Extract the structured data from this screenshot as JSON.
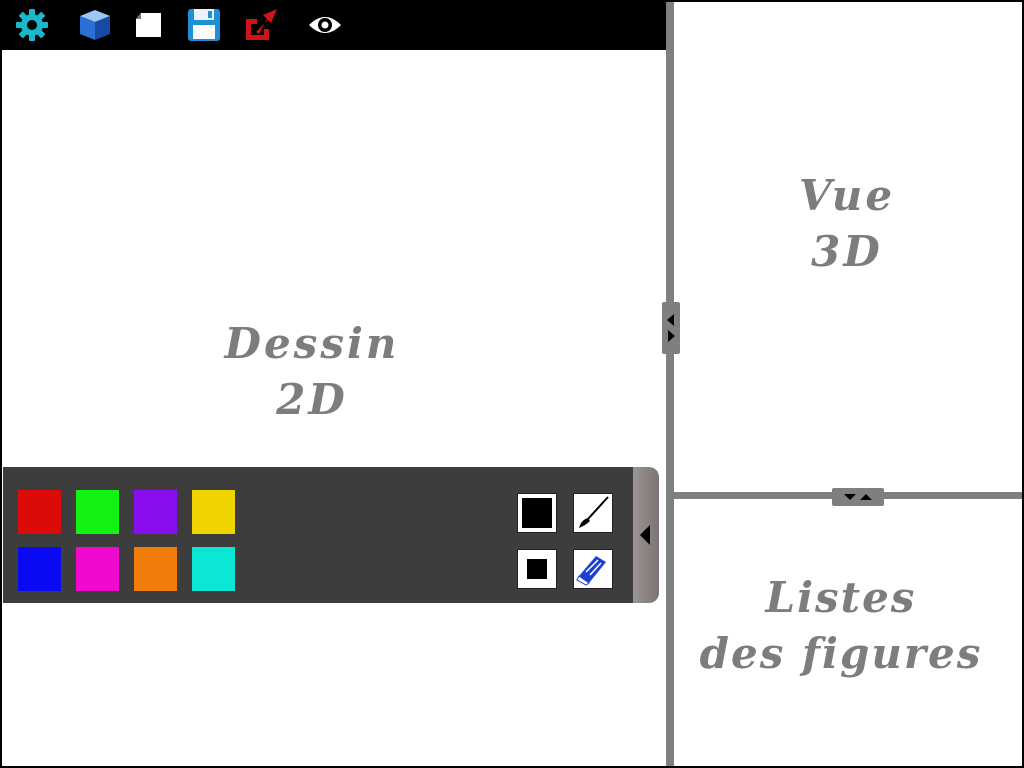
{
  "toolbar": {
    "buttons": [
      {
        "name": "settings",
        "icon": "gear-icon",
        "color": "#19b8cc"
      },
      {
        "name": "3d-view",
        "icon": "cube-icon",
        "color": "#2d6fd6"
      },
      {
        "name": "new-document",
        "icon": "page-icon",
        "color": "#ffffff"
      },
      {
        "name": "save",
        "icon": "floppy-disk-icon",
        "color": "#1f8fd8"
      },
      {
        "name": "export",
        "icon": "share-arrow-icon",
        "color": "#d0141a"
      },
      {
        "name": "visibility",
        "icon": "eye-icon",
        "color": "#ffffff"
      }
    ]
  },
  "panels": {
    "drawing": {
      "line1": "Dessin",
      "line2": "2D"
    },
    "view3d": {
      "line1": "Vue",
      "line2": "3D"
    },
    "figures": {
      "line1": "Listes",
      "line2": "des figures"
    }
  },
  "palette": {
    "colors": [
      "#dd0a0a",
      "#13f313",
      "#8a0ff0",
      "#f0d400",
      "#0a0af2",
      "#f00ad0",
      "#f07d0a",
      "#0ae8d3"
    ],
    "tools": [
      {
        "name": "fill-square",
        "icon": "filled-square-icon"
      },
      {
        "name": "brush",
        "icon": "paintbrush-icon"
      },
      {
        "name": "small-square",
        "icon": "small-square-icon"
      },
      {
        "name": "eraser",
        "icon": "eraser-icon"
      }
    ]
  }
}
